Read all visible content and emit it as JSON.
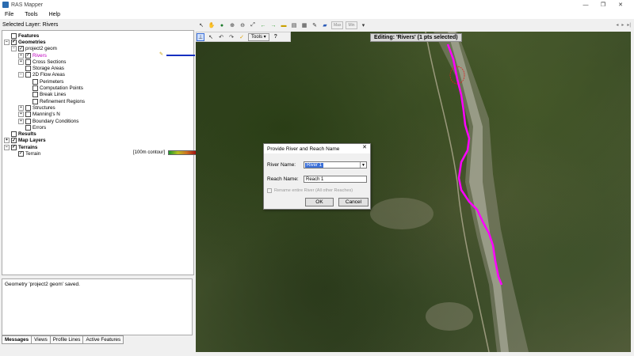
{
  "window": {
    "title": "RAS Mapper",
    "min": "—",
    "max": "❐",
    "close": "✕"
  },
  "menu": [
    "File",
    "Tools",
    "Help"
  ],
  "selected_layer": "Selected Layer: Rivers",
  "toolbar": {
    "max_label": "Max",
    "min_label": "Min",
    "tools_label": "Tools",
    "help_label": "?"
  },
  "tree": {
    "features": "Features",
    "geometries": "Geometries",
    "project_geom": "project2 geom",
    "rivers": "Rivers",
    "cross_sections": "Cross Sections",
    "storage_areas": "Storage Areas",
    "flow_areas_2d": "2D Flow Areas",
    "perimeters": "Perimeters",
    "computation_points": "Computation Points",
    "break_lines": "Break Lines",
    "refinement_regions": "Refinement Regions",
    "structures": "Structures",
    "mannings_n": "Manning's N",
    "boundary_conditions": "Boundary Conditions",
    "errors": "Errors",
    "results": "Results",
    "map_layers": "Map Layers",
    "terrains": "Terrains",
    "terrain": "Terrain",
    "terrain_legend": "[100m contour]"
  },
  "messages": {
    "text": "Geometry 'project2 geom' saved."
  },
  "tabs": [
    "Messages",
    "Views",
    "Profile Lines",
    "Active Features"
  ],
  "editing_label": "Editing: 'Rivers' (1 pts selected)",
  "dialog": {
    "title": "Provide River and Reach Name",
    "river_label": "River Name:",
    "river_value": "River 1",
    "reach_label": "Reach Name:",
    "reach_value": "Reach 1",
    "rename_label": "Rename entire River (All other Reaches)",
    "ok": "OK",
    "cancel": "Cancel"
  },
  "colors": {
    "river": "#ff00ff",
    "legend_line": "#1530c0"
  }
}
